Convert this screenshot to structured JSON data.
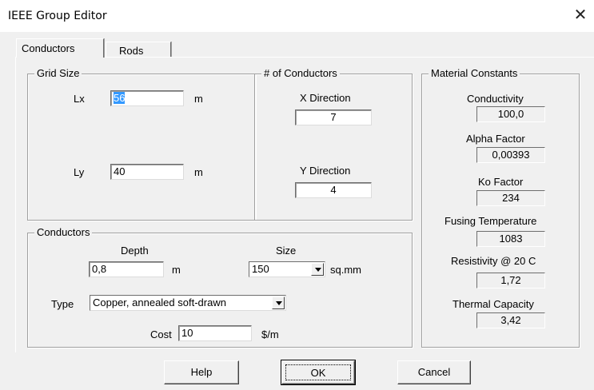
{
  "window": {
    "title": "IEEE Group Editor",
    "close_glyph": "✕"
  },
  "tabs": [
    {
      "label": "Conductors",
      "active": true
    },
    {
      "label": "Rods",
      "active": false
    }
  ],
  "grid_size": {
    "legend": "Grid Size",
    "lx_label": "Lx",
    "lx_value": "56",
    "lx_unit": "m",
    "ly_label": "Ly",
    "ly_value": "40",
    "ly_unit": "m"
  },
  "num_conductors": {
    "legend": "# of Conductors",
    "x_label": "X Direction",
    "x_value": "7",
    "y_label": "Y Direction",
    "y_value": "4"
  },
  "conductors": {
    "legend": "Conductors",
    "depth_label": "Depth",
    "depth_value": "0,8",
    "depth_unit": "m",
    "size_label": "Size",
    "size_value": "150",
    "size_unit": "sq.mm",
    "type_label": "Type",
    "type_value": "Copper, annealed soft-drawn",
    "cost_label": "Cost",
    "cost_value": "10",
    "cost_unit": "$/m"
  },
  "material_constants": {
    "legend": "Material Constants",
    "conductivity_label": "Conductivity",
    "conductivity_value": "100,0",
    "alpha_label": "Alpha Factor",
    "alpha_value": "0,00393",
    "ko_label": "Ko Factor",
    "ko_value": "234",
    "fusing_label": "Fusing Temperature",
    "fusing_value": "1083",
    "resistivity_label": "Resistivity @ 20 C",
    "resistivity_value": "1,72",
    "thermal_label": "Thermal Capacity",
    "thermal_value": "3,42"
  },
  "buttons": {
    "help": "Help",
    "ok": "OK",
    "cancel": "Cancel"
  }
}
